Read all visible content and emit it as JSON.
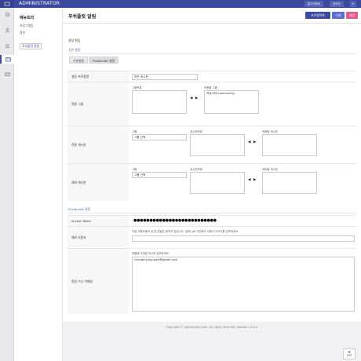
{
  "topbar": {
    "brand": "ADMINISTRATOR",
    "btn_home": "홈가이버이",
    "btn_admin": "관리자",
    "btn_more": "▾"
  },
  "sidebar": {
    "title": "메뉴트리",
    "items": [
      {
        "label": "프로그램등"
      },
      {
        "label": "정보"
      },
      {
        "label": "푸쉬플릿 알림"
      }
    ]
  },
  "header": {
    "title": "푸쉬플릿 알림",
    "btn_list": "프로필목록",
    "btn_delete": "삭제",
    "btn_save": "저장"
  },
  "form": {
    "edit_title": "설정 편집",
    "basic_section": "기본 설정",
    "tabs": [
      "기본설정",
      "Pushbullet 설정"
    ],
    "profile_name_label": "설정 프로필명",
    "profile_name_value": "모든 게시판",
    "apply_group_label": "적용 그룹",
    "group_list_caption": "그룹목록",
    "applied_group_caption": "적용할 그룹",
    "applied_group_item": "커뮤니티(community)",
    "apply_board_label": "적용 게시판",
    "exclude_board_label": "제외 게시판",
    "group_caption": "그룹",
    "group_select": "그룹 선택",
    "board_list_caption": "게시판목록",
    "apply_board_caption": "적용할 게시판",
    "exclude_board_caption": "제외할 게시판",
    "push_section": "Pushbullet 설정",
    "token_label": "Access Token",
    "token_value": "●●●●●●●●●●●●●●●●●●●●●●●●●●",
    "exclude_user_label": "제외 사용자",
    "exclude_user_help": "다음 사용자들의 글 및 댓글은 알리지 않습니다. 쉼마(,)로 구분해서 사용자 아이디를 입력하세요.",
    "email_label": "알림 수신 이메일",
    "email_help": "한줄에 이메일 하나씩 입력하세요",
    "email_value": "chongmyung.park@gmail.com"
  },
  "footer": {
    "copyright": "Copyright © xlerszbyfun.com. All rights reserved. Version 1.3.2.4",
    "top_button": "TOP"
  },
  "colors": {
    "brand": "#3b4a9e",
    "list_btn": "#3b4a9e",
    "delete_btn": "#5a6ed0",
    "save_btn": "#e05b8a"
  }
}
